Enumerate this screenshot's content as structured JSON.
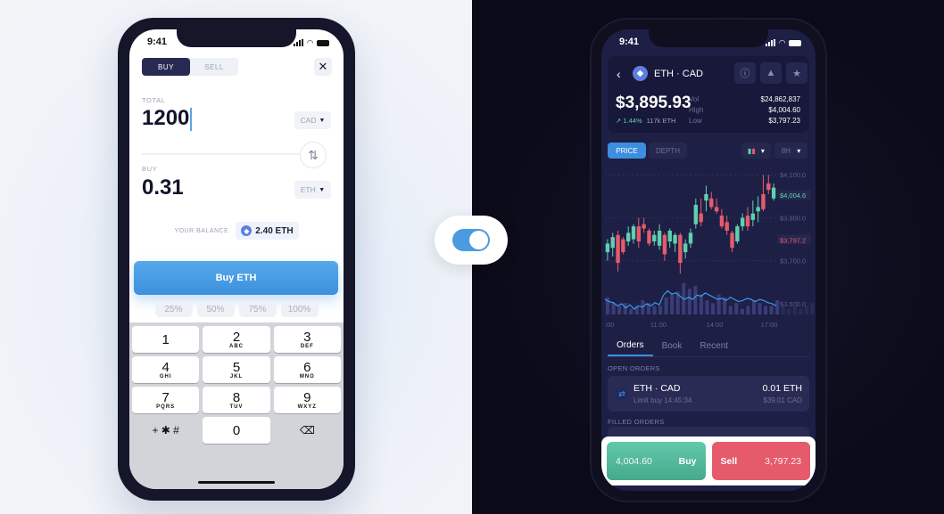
{
  "left_phone": {
    "status": {
      "time": "9:41"
    },
    "segment": {
      "buy": "BUY",
      "sell": "SELL",
      "active": "buy"
    },
    "close_icon": "✕",
    "total": {
      "label": "TOTAL",
      "value": "1200",
      "currency": "CAD"
    },
    "buy": {
      "label": "BUY",
      "value": "0.31",
      "currency": "ETH"
    },
    "swap_icon": "⇅",
    "balance": {
      "label": "YOUR BALANCE",
      "value": "2.40 ETH",
      "icon": "eth-icon"
    },
    "buy_button": "Buy ETH",
    "percents": [
      "25%",
      "50%",
      "75%",
      "100%"
    ],
    "keypad": [
      [
        {
          "n": "1",
          "s": ""
        },
        {
          "n": "2",
          "s": "ABC"
        },
        {
          "n": "3",
          "s": "DEF"
        }
      ],
      [
        {
          "n": "4",
          "s": "GHI"
        },
        {
          "n": "5",
          "s": "JKL"
        },
        {
          "n": "6",
          "s": "MNO"
        }
      ],
      [
        {
          "n": "7",
          "s": "PQRS"
        },
        {
          "n": "8",
          "s": "TUV"
        },
        {
          "n": "9",
          "s": "WXYZ"
        }
      ]
    ],
    "keypad_bottom": {
      "symbols": "+ ✱ #",
      "zero": "0",
      "delete_icon": "⌫"
    }
  },
  "toggle": {
    "state": "on",
    "color": "#4b9be0"
  },
  "right_phone": {
    "status": {
      "time": "9:41"
    },
    "header": {
      "back_icon": "‹",
      "pair": "ETH · CAD",
      "info_icon": "ⓘ",
      "bell_icon": "🔔",
      "star_icon": "★",
      "price": "$3,895.93",
      "change": "1.44%",
      "volume_eth": "117k ETH",
      "stats": [
        {
          "k": "Vol",
          "v": "$24,862,837"
        },
        {
          "k": "High",
          "v": "$4,004.60"
        },
        {
          "k": "Low",
          "v": "$3,797.23"
        }
      ]
    },
    "chart_tabs": {
      "price": "PRICE",
      "depth": "DEPTH",
      "active": "price"
    },
    "interval": "8H",
    "order_tabs": [
      "Orders",
      "Book",
      "Recent"
    ],
    "open_orders_label": "OPEN ORDERS",
    "open_order": {
      "pair": "ETH · CAD",
      "sub": "Limit buy 14:45:34",
      "amount": "0.01 ETH",
      "cad": "$39.01 CAD"
    },
    "filled_orders_label": "FILLED ORDERS",
    "trade": {
      "buy_price": "4,004.60",
      "buy_label": "Buy",
      "sell_label": "Sell",
      "sell_price": "3,797.23"
    }
  },
  "chart_data": {
    "type": "candlestick",
    "y_ticks": [
      "$4,100.0",
      "$3,900.0",
      "$3,700.0",
      "$3,500.0"
    ],
    "y_tick_values": [
      4100,
      3900,
      3700,
      3500
    ],
    "high_marker": {
      "label": "$4,004.6",
      "value": 4004.6,
      "color": "#5fd0ad"
    },
    "low_marker": {
      "label": "$3,797.2",
      "value": 3797.2,
      "color": "#e55b6b"
    },
    "x_ticks": [
      ":00",
      "11:00",
      "14:00",
      "17:00"
    ],
    "ylim": [
      3450,
      4130
    ],
    "candles": [
      [
        3740,
        3780,
        3700,
        3800
      ],
      [
        3760,
        3810,
        3720,
        3830
      ],
      [
        3820,
        3690,
        3650,
        3840
      ],
      [
        3800,
        3740,
        3730,
        3810
      ],
      [
        3790,
        3830,
        3770,
        3860
      ],
      [
        3800,
        3860,
        3780,
        3870
      ],
      [
        3860,
        3790,
        3760,
        3900
      ],
      [
        3870,
        3850,
        3830,
        3900
      ],
      [
        3840,
        3780,
        3770,
        3850
      ],
      [
        3790,
        3820,
        3770,
        3840
      ],
      [
        3770,
        3840,
        3750,
        3870
      ],
      [
        3820,
        3730,
        3700,
        3830
      ],
      [
        3790,
        3840,
        3760,
        3850
      ],
      [
        3780,
        3820,
        3740,
        3830
      ],
      [
        3820,
        3690,
        3640,
        3830
      ],
      [
        3740,
        3780,
        3710,
        3800
      ],
      [
        3780,
        3830,
        3760,
        3850
      ],
      [
        3870,
        3960,
        3850,
        3990
      ],
      [
        3920,
        3880,
        3860,
        3990
      ],
      [
        3980,
        4010,
        3930,
        4050
      ],
      [
        3990,
        3950,
        3940,
        4020
      ],
      [
        3950,
        3930,
        3920,
        3990
      ],
      [
        3910,
        3860,
        3850,
        3940
      ],
      [
        3880,
        3840,
        3820,
        3910
      ],
      [
        3830,
        3760,
        3740,
        3840
      ],
      [
        3790,
        3860,
        3780,
        3870
      ],
      [
        3860,
        3900,
        3840,
        3920
      ],
      [
        3910,
        3860,
        3840,
        3950
      ],
      [
        3890,
        3920,
        3860,
        3980
      ],
      [
        3930,
        3950,
        3880,
        4000
      ],
      [
        4010,
        3940,
        3930,
        4100
      ],
      [
        4060,
        4030,
        4010,
        4100
      ],
      [
        3990,
        4040,
        3980,
        4060
      ]
    ],
    "line": [
      3520,
      3510,
      3505,
      3490,
      3500,
      3480,
      3495,
      3475,
      3490,
      3485,
      3500,
      3490,
      3505,
      3495,
      3540,
      3560,
      3545,
      3550,
      3535,
      3520,
      3530,
      3520,
      3540,
      3535,
      3550,
      3540,
      3530,
      3520,
      3525,
      3515,
      3530,
      3520,
      3510,
      3515,
      3525,
      3520,
      3510,
      3520,
      3515,
      3505,
      3500,
      3490
    ],
    "volume": [
      6,
      4,
      3,
      4,
      2,
      3,
      5,
      4,
      3,
      3,
      6,
      7,
      8,
      11,
      9,
      10,
      7,
      5,
      4,
      7,
      6,
      3,
      4,
      2,
      3,
      5,
      4,
      3,
      3,
      5,
      3,
      2,
      3,
      2,
      3,
      4
    ]
  }
}
